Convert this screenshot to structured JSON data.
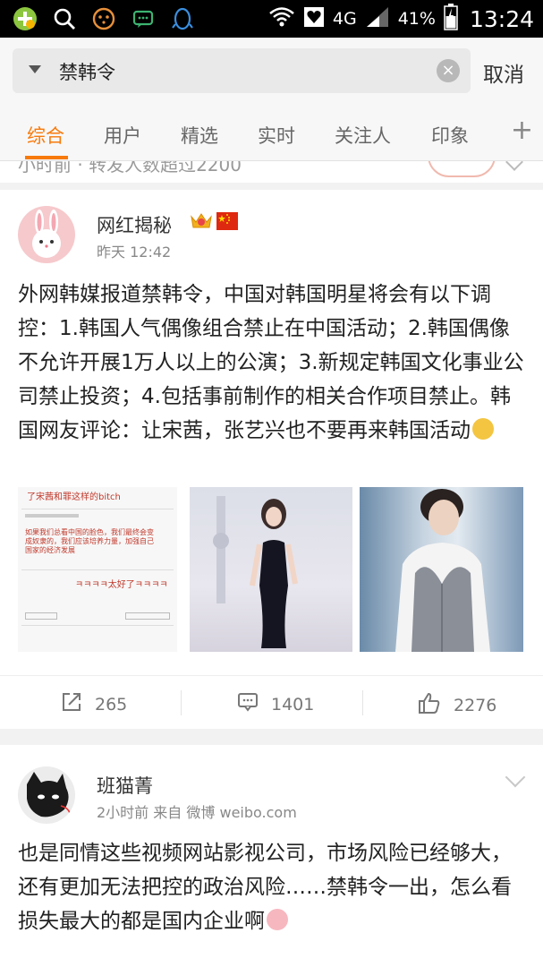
{
  "status_bar": {
    "signal_type": "4G",
    "battery": "41%",
    "time": "13:24",
    "icons": [
      "plus-circle-icon",
      "search-icon",
      "face-icon",
      "chat-icon",
      "qq-penguin-icon",
      "wifi-icon",
      "heart-notification-icon",
      "signal-icon",
      "battery-icon"
    ]
  },
  "search": {
    "query": "禁韩令",
    "cancel_label": "取消"
  },
  "tabs": [
    {
      "label": "综合",
      "active": true
    },
    {
      "label": "用户"
    },
    {
      "label": "精选"
    },
    {
      "label": "实时"
    },
    {
      "label": "关注人"
    },
    {
      "label": "印象"
    }
  ],
  "partial_previous": {
    "text": "小时前 · 转发人数超过2200"
  },
  "post1": {
    "user": "网红揭秘",
    "time": "昨天 12:42",
    "text": "外网韩媒报道禁韩令，中国对韩国明星将会有以下调控：1.韩国人气偶像组合禁止在中国活动；2.韩国偶像不允许开展1万人以上的公演；3.新规定韩国文化事业公司禁止投资；4.包括事前制作的相关合作项目禁止。韩国网友评论：让宋茜，张艺兴也不要再来韩国活动",
    "image1": {
      "caption_top": "了宋茜和罪这样的bitch",
      "caption_mid": "如果我们总看中国的脸色，我们最终会变成奴隶的，我们应该培养力量，加强自己国家的经济发展",
      "caption_laugh": "ㅋㅋㅋㅋ太好了ㅋㅋㅋㅋ"
    },
    "reposts": "265",
    "comments": "1401",
    "likes": "2276"
  },
  "post2": {
    "user": "班猫菁",
    "time": "2小时前",
    "source_prefix": "来自",
    "source": "微博 weibo.com",
    "text": "也是同情这些视频网站影视公司，市场风险已经够大，还有更加无法把控的政治风险……禁韩令一出，怎么看损失最大的都是国内企业啊"
  },
  "colors": {
    "accent": "#f77a0c",
    "status_bar_bg": "#000000",
    "header_bg": "#f7f7f7"
  }
}
